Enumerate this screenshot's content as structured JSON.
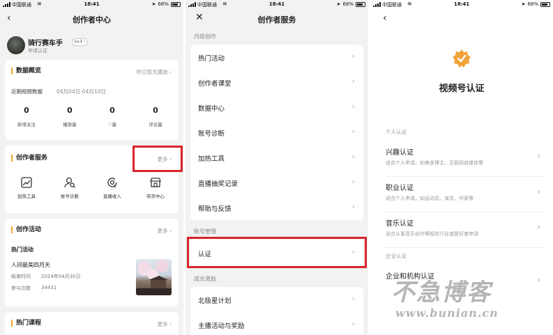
{
  "status": {
    "carrier": "中国联通",
    "time": "18:41",
    "battery": "68%"
  },
  "panel1": {
    "title": "创作者中心",
    "profile": {
      "name": "骑行赛车手",
      "level": "Lv.1",
      "level_arrow": "›",
      "sub": "申请认证"
    },
    "overview": {
      "title": "数据概览",
      "note": "昨日暂无播放 ›",
      "recent_label": "近期视频数据",
      "date_range": "04月04日-04月10日",
      "stats": [
        {
          "value": "0",
          "label": "新增关注"
        },
        {
          "value": "0",
          "label": "播放量"
        },
        {
          "value": "0",
          "label": "♡量"
        },
        {
          "value": "0",
          "label": "评论量"
        }
      ]
    },
    "services": {
      "title": "创作者服务",
      "more": "更多 ›",
      "items": [
        {
          "label": "加热工具",
          "icon": "chart-trend-icon"
        },
        {
          "label": "账号诊断",
          "icon": "person-search-icon"
        },
        {
          "label": "直播收入",
          "icon": "live-income-icon"
        },
        {
          "label": "带货中心",
          "icon": "store-icon"
        }
      ]
    },
    "activity": {
      "title": "创作活动",
      "more": "更多 ›",
      "hot": "热门活动",
      "name": "人间最美四月天",
      "end_label": "结束时间",
      "end_date": "2024年04月30日",
      "count_label": "参与次数",
      "count": "34431"
    },
    "courses": {
      "title": "热门课程",
      "more": "更多 ›"
    }
  },
  "panel2": {
    "title": "创作者服务",
    "groups": [
      {
        "label": "内容创作",
        "items": [
          "热门活动",
          "创作者课堂",
          "数据中心",
          "账号诊断",
          "加热工具",
          "直播抽奖记录",
          "帮助与反馈"
        ]
      },
      {
        "label": "账号管理",
        "items": [
          "认证"
        ]
      },
      {
        "label": "成长激励",
        "items": [
          "北极星计划",
          "主播活动与奖励"
        ]
      }
    ]
  },
  "panel3": {
    "title": "视频号认证",
    "personal_label": "个人认证",
    "personal": [
      {
        "title": "兴趣认证",
        "desc": "适合个人申请，如美食博主、互联网自媒体等"
      },
      {
        "title": "职业认证",
        "desc": "适合个人申请，如运动员、演员、作家等"
      },
      {
        "title": "音乐认证",
        "desc": "适合从事音乐创作等相关行业或爱好者申请"
      }
    ],
    "org_label": "企业认证",
    "org": [
      {
        "title": "企业和机构认证",
        "desc": ""
      }
    ]
  },
  "watermark": {
    "brand": "不急博客",
    "url": "www.bunian.cn"
  },
  "colors": {
    "accent": "#f4a52a",
    "highlight": "#d9252a",
    "badge": "#f0a33a"
  }
}
